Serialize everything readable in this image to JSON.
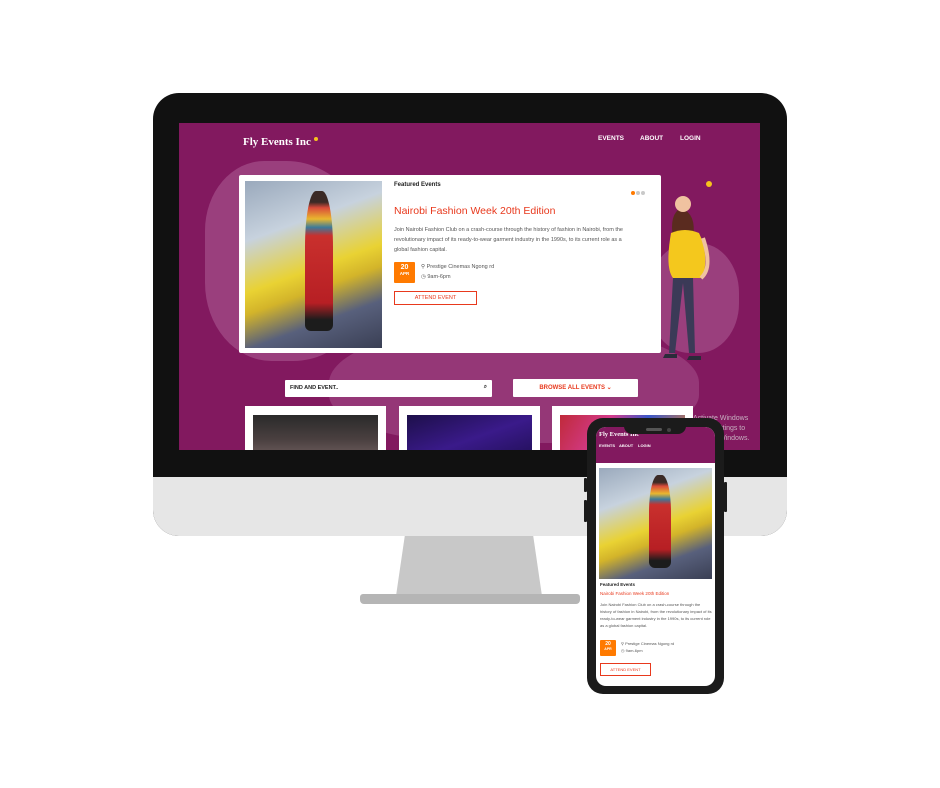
{
  "brand": {
    "name": "Fly Events Inc"
  },
  "nav": {
    "events": "EVENTS",
    "about": "ABOUT",
    "login": "LOGIN"
  },
  "featured": {
    "heading": "Featured Events",
    "title": "Nairobi Fashion Week 20th Edition",
    "description": "Join Nairobi Fashion Club on a crash-course through the history of fashion in Nairobi, from the revolutionary impact of its ready-to-wear garment industry in the 1990s, to its current role as a global fashion capital.",
    "date_day": "20",
    "date_month": "APR",
    "venue": "Prestige Cinemas Ngong rd",
    "time": "9am-6pm",
    "cta": "ATTEND EVENT"
  },
  "search": {
    "placeholder": "FIND AND EVENT.."
  },
  "browse": {
    "label": "BROWSE ALL EVENTS"
  },
  "watermark": {
    "line1": "Activate Windows",
    "line2": "Go to Settings to activate Windows."
  },
  "phone": {
    "description": "Join Nairobi Fashion Club on a crash-course through the history of fashion in Nairobi, from the revolutionary impact of its ready-to-wear garment industry in the 1990s, to its current role as a global fashion capital."
  },
  "colors": {
    "brand": "#82195f",
    "accent": "#e8391d",
    "date": "#ff7a00"
  },
  "icons": {
    "search": "search-icon",
    "location": "map-pin-icon",
    "time": "clock-icon",
    "chevron": "chevron-down-icon"
  }
}
